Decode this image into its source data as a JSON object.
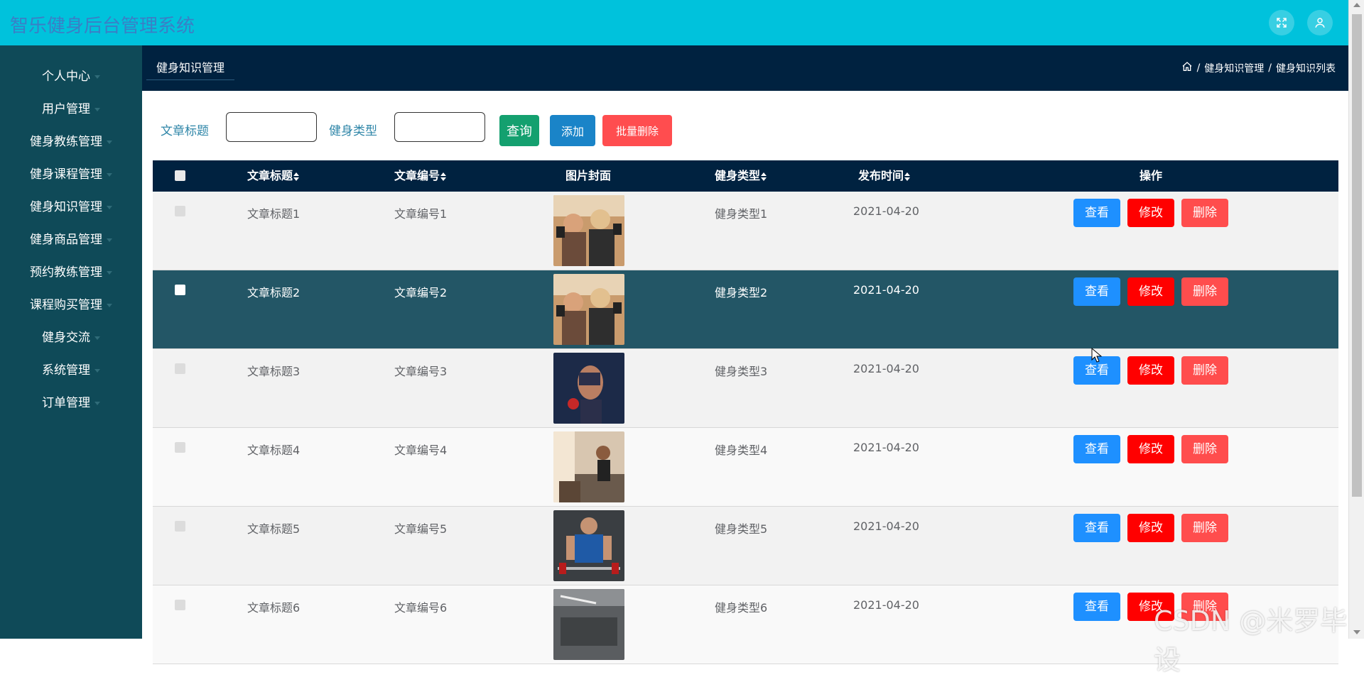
{
  "app": {
    "title": "智乐健身后台管理系统"
  },
  "topbar": {
    "icons": [
      "fullscreen-icon",
      "user-icon"
    ]
  },
  "sidebar": {
    "items": [
      {
        "label": "个人中心"
      },
      {
        "label": "用户管理"
      },
      {
        "label": "健身教练管理"
      },
      {
        "label": "健身课程管理"
      },
      {
        "label": "健身知识管理"
      },
      {
        "label": "健身商品管理"
      },
      {
        "label": "预约教练管理"
      },
      {
        "label": "课程购买管理"
      },
      {
        "label": "健身交流"
      },
      {
        "label": "系统管理"
      },
      {
        "label": "订单管理"
      }
    ]
  },
  "page_header": {
    "tab": "健身知识管理",
    "breadcrumb": {
      "home_icon": "home-icon",
      "sep": "/",
      "level1": "健身知识管理",
      "level2": "健身知识列表"
    }
  },
  "search": {
    "title_label": "文章标题",
    "title_value": "",
    "type_label": "健身类型",
    "type_value": "",
    "query_label": "查询",
    "add_label": "添加",
    "batch_delete_label": "批量删除"
  },
  "table": {
    "headers": {
      "title": "文章标题",
      "number": "文章编号",
      "cover": "图片封面",
      "type": "健身类型",
      "date": "发布时间",
      "actions": "操作"
    },
    "rows": [
      {
        "title": "文章标题1",
        "number": "文章编号1",
        "type": "健身类型1",
        "date": "2021-04-20",
        "highlight": false
      },
      {
        "title": "文章标题2",
        "number": "文章编号2",
        "type": "健身类型2",
        "date": "2021-04-20",
        "highlight": true
      },
      {
        "title": "文章标题3",
        "number": "文章编号3",
        "type": "健身类型3",
        "date": "2021-04-20",
        "highlight": false
      },
      {
        "title": "文章标题4",
        "number": "文章编号4",
        "type": "健身类型4",
        "date": "2021-04-20",
        "highlight": false
      },
      {
        "title": "文章标题5",
        "number": "文章编号5",
        "type": "健身类型5",
        "date": "2021-04-20",
        "highlight": false
      },
      {
        "title": "文章标题6",
        "number": "文章编号6",
        "type": "健身类型6",
        "date": "2021-04-20",
        "highlight": false
      }
    ],
    "actions": {
      "view": "查看",
      "edit": "修改",
      "delete": "删除"
    }
  },
  "watermark": "CSDN @米罗毕设",
  "colors": {
    "topbar": "#00c2dc",
    "sidebar": "#0f4a58",
    "header": "#002240",
    "highlight_row": "#235666",
    "query": "#14a06f",
    "add": "#1a84c8",
    "danger": "#ff4d4f",
    "view": "#1e90ff",
    "edit": "#ff0000"
  }
}
